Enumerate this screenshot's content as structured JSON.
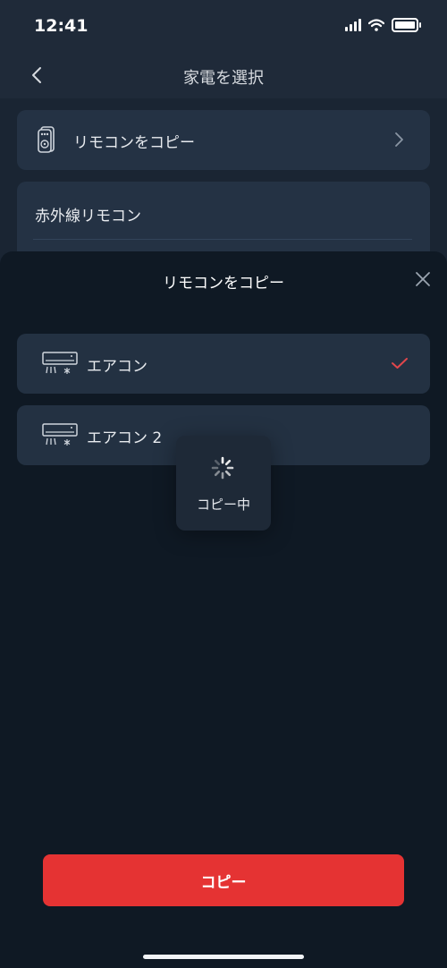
{
  "status_bar": {
    "time": "12:41"
  },
  "nav": {
    "title": "家電を選択"
  },
  "cards": {
    "copy_remote_label": "リモコンをコピー",
    "ir_remote_label": "赤外線リモコン"
  },
  "sheet": {
    "title": "リモコンをコピー",
    "options": [
      {
        "label": "エアコン",
        "selected": true
      },
      {
        "label": "エアコン 2",
        "selected": false
      }
    ]
  },
  "toast": {
    "label": "コピー中"
  },
  "button": {
    "copy_label": "コピー"
  },
  "colors": {
    "accent": "#e53333",
    "check": "#e0464b"
  }
}
